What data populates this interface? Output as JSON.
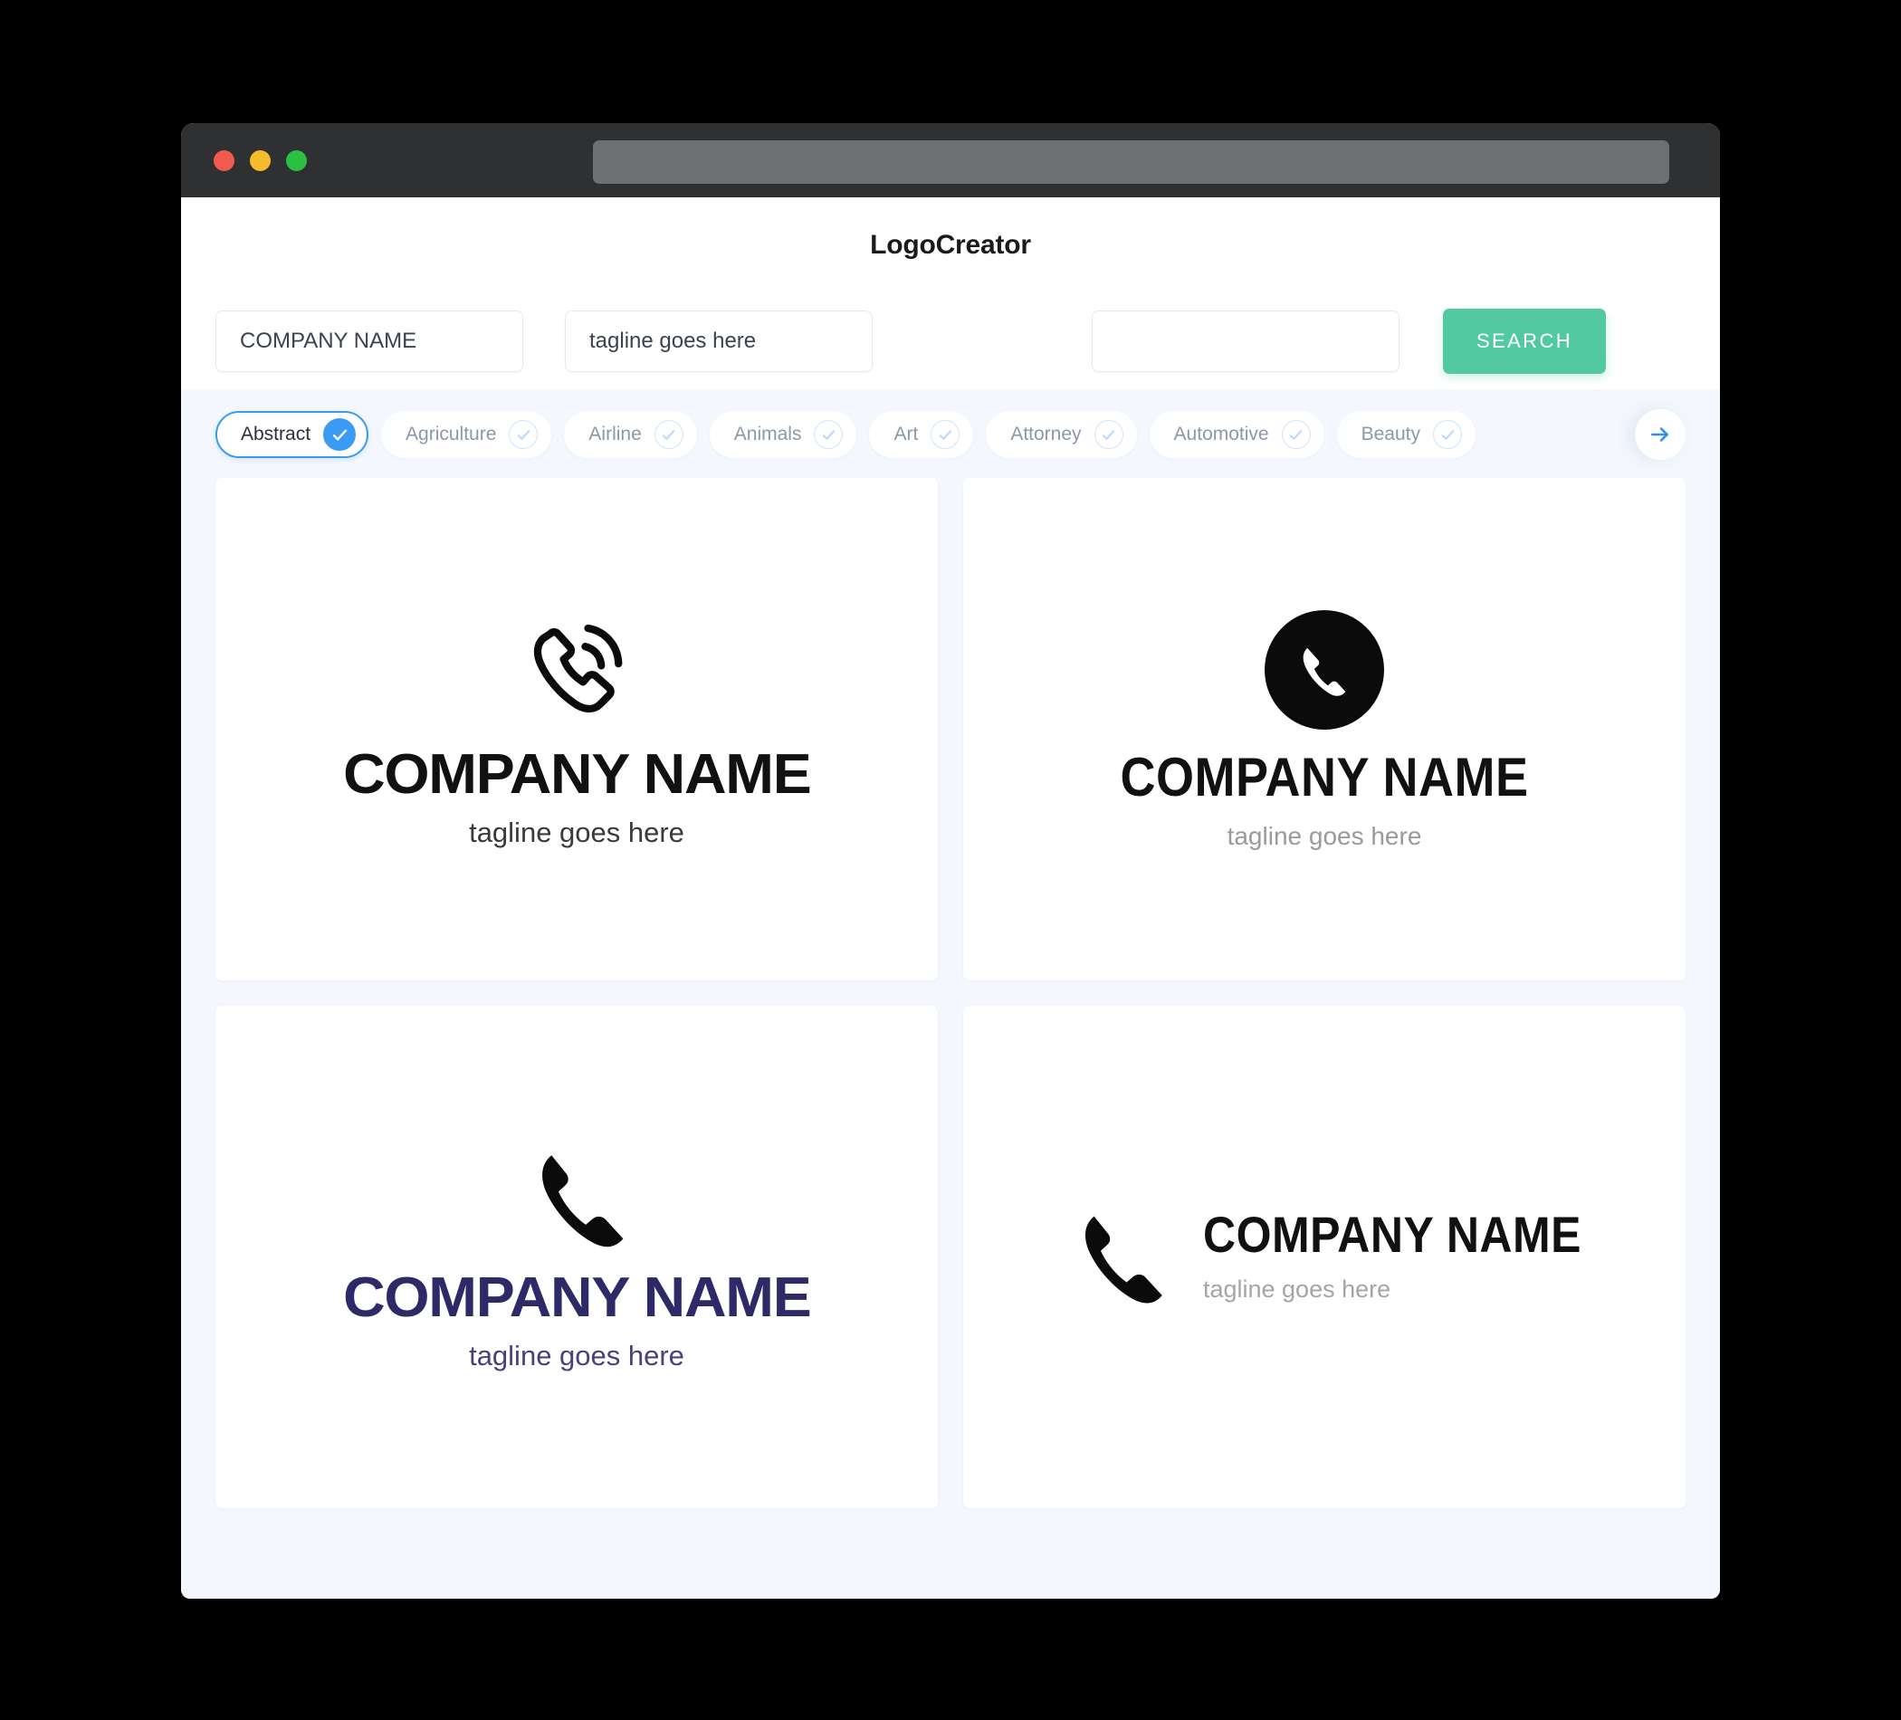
{
  "window": {
    "traffic_lights": [
      "close",
      "minimize",
      "maximize"
    ],
    "url_value": ""
  },
  "header": {
    "title": "LogoCreator"
  },
  "search": {
    "company_value": "COMPANY NAME",
    "tagline_value": "tagline goes here",
    "extra_value": "",
    "search_label": "SEARCH"
  },
  "categories": {
    "items": [
      {
        "label": "Abstract",
        "selected": true
      },
      {
        "label": "Agriculture",
        "selected": false
      },
      {
        "label": "Airline",
        "selected": false
      },
      {
        "label": "Animals",
        "selected": false
      },
      {
        "label": "Art",
        "selected": false
      },
      {
        "label": "Attorney",
        "selected": false
      },
      {
        "label": "Automotive",
        "selected": false
      },
      {
        "label": "Beauty",
        "selected": false
      }
    ],
    "next_icon": "arrow-right-icon"
  },
  "results": {
    "cards": [
      {
        "mark": "phone-outline-with-waves-icon",
        "name": "COMPANY NAME",
        "tagline": "tagline goes here",
        "layout": "stacked",
        "name_color": "#111111",
        "tagline_color": "#3a3a3a"
      },
      {
        "mark": "phone-in-black-circle-icon",
        "name": "COMPANY NAME",
        "tagline": "tagline goes here",
        "layout": "stacked",
        "name_color": "#111111",
        "tagline_color": "#9a9a9a"
      },
      {
        "mark": "phone-solid-icon",
        "name": "COMPANY NAME",
        "tagline": "tagline goes here",
        "layout": "stacked",
        "name_color": "#2e2a68",
        "tagline_color": "#474180"
      },
      {
        "mark": "phone-solid-icon",
        "name": "COMPANY NAME",
        "tagline": "tagline goes here",
        "layout": "horizontal",
        "name_color": "#111111",
        "tagline_color": "#a5a5a5"
      }
    ]
  },
  "colors": {
    "accent_green": "#52c9a0",
    "accent_blue": "#3a9bf4",
    "page_bg": "#f4f7fd",
    "titlebar": "#2f3032",
    "navy": "#2e2a68"
  }
}
